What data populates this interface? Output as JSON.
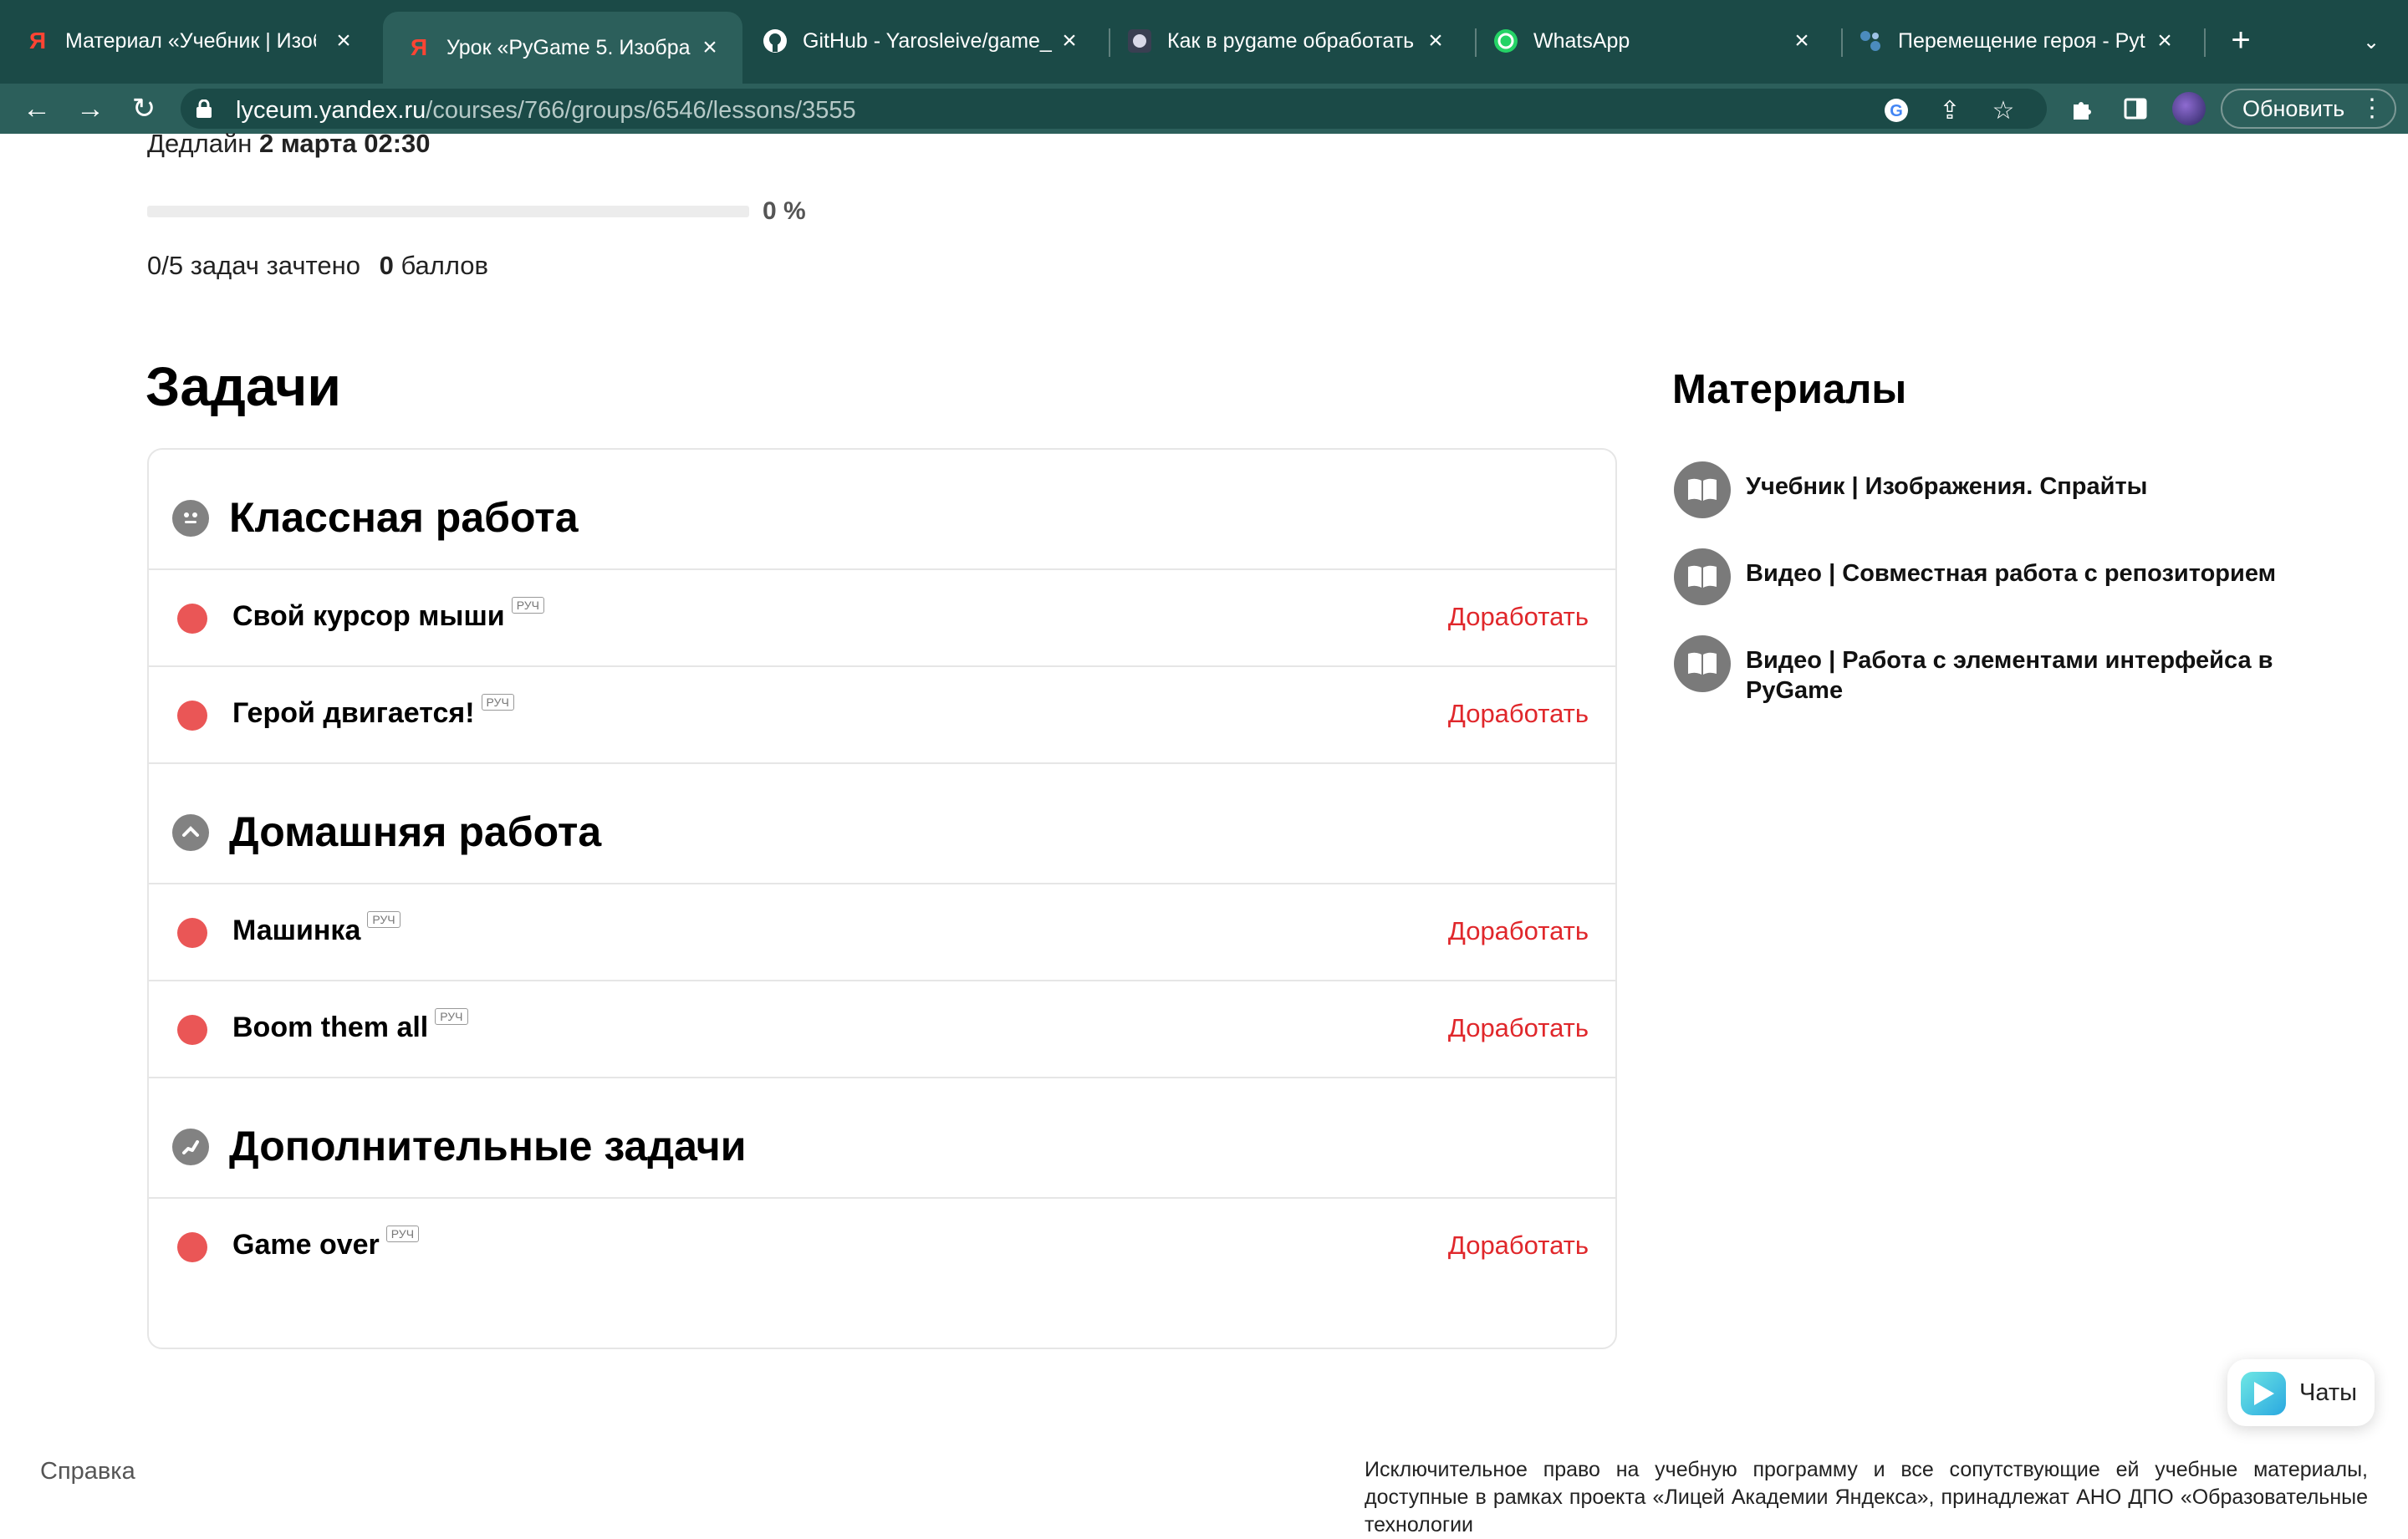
{
  "browser": {
    "tabs": [
      {
        "favicon": "yandex-icon",
        "title": "Материал «Учебник | Изоб",
        "active": false
      },
      {
        "favicon": "yandex-icon",
        "title": "Урок «PyGame 5. Изобра",
        "active": true
      },
      {
        "favicon": "github-icon",
        "title": "GitHub - Yarosleive/game_",
        "active": false
      },
      {
        "favicon": "site-icon",
        "title": "Как в pygame обработать",
        "active": false
      },
      {
        "favicon": "whatsapp-icon",
        "title": "WhatsApp",
        "active": false
      },
      {
        "favicon": "python-icon",
        "title": "Перемещение героя - Pyt",
        "active": false
      }
    ],
    "url_host": "lyceum.yandex.ru",
    "url_path": "/courses/766/groups/6546/lessons/3555",
    "update_button": "Обновить",
    "colors": {
      "tabbar": "#1b4a47",
      "toolbar": "#2c5f5b"
    }
  },
  "lesson": {
    "deadline_label": "Дедлайн",
    "deadline_value": "2 марта 02:30",
    "progress_percent": 0,
    "progress_label": "0 %",
    "solved": "0/5 задач зачтено",
    "points_value": "0",
    "points_label": "баллов"
  },
  "tasks": {
    "title": "Задачи",
    "sections": [
      {
        "title": "Классная работа",
        "icon": "classwork-icon",
        "items": [
          {
            "name": "Свой курсор мыши",
            "tag": "РУЧ",
            "action": "Доработать"
          },
          {
            "name": "Герой двигается!",
            "tag": "РУЧ",
            "action": "Доработать"
          }
        ]
      },
      {
        "title": "Домашняя работа",
        "icon": "homework-icon",
        "items": [
          {
            "name": "Машинка",
            "tag": "РУЧ",
            "action": "Доработать"
          },
          {
            "name": "Boom them all",
            "tag": "РУЧ",
            "action": "Доработать"
          }
        ]
      },
      {
        "title": "Дополнительные задачи",
        "icon": "extra-tasks-icon",
        "items": [
          {
            "name": "Game over",
            "tag": "РУЧ",
            "action": "Доработать"
          }
        ]
      }
    ],
    "status_color": "#ea5656",
    "action_color": "#e0272b"
  },
  "materials": {
    "title": "Материалы",
    "items": [
      {
        "icon": "book-icon",
        "label": "Учебник | Изображения. Спрайты"
      },
      {
        "icon": "book-icon",
        "label": "Видео | Совместная работа с репозиторием"
      },
      {
        "icon": "book-icon",
        "label": "Видео | Работа с элементами интерфейса в PyGame"
      }
    ]
  },
  "footer": {
    "help": "Справка",
    "copyright": "Исключительное право на учебную программу и все сопутствующие ей учебные материалы, доступные в рамках проекта «Лицей Академии Яндекса», принадлежат АНО ДПО «Образовательные технологии"
  },
  "chats": {
    "label": "Чаты"
  }
}
